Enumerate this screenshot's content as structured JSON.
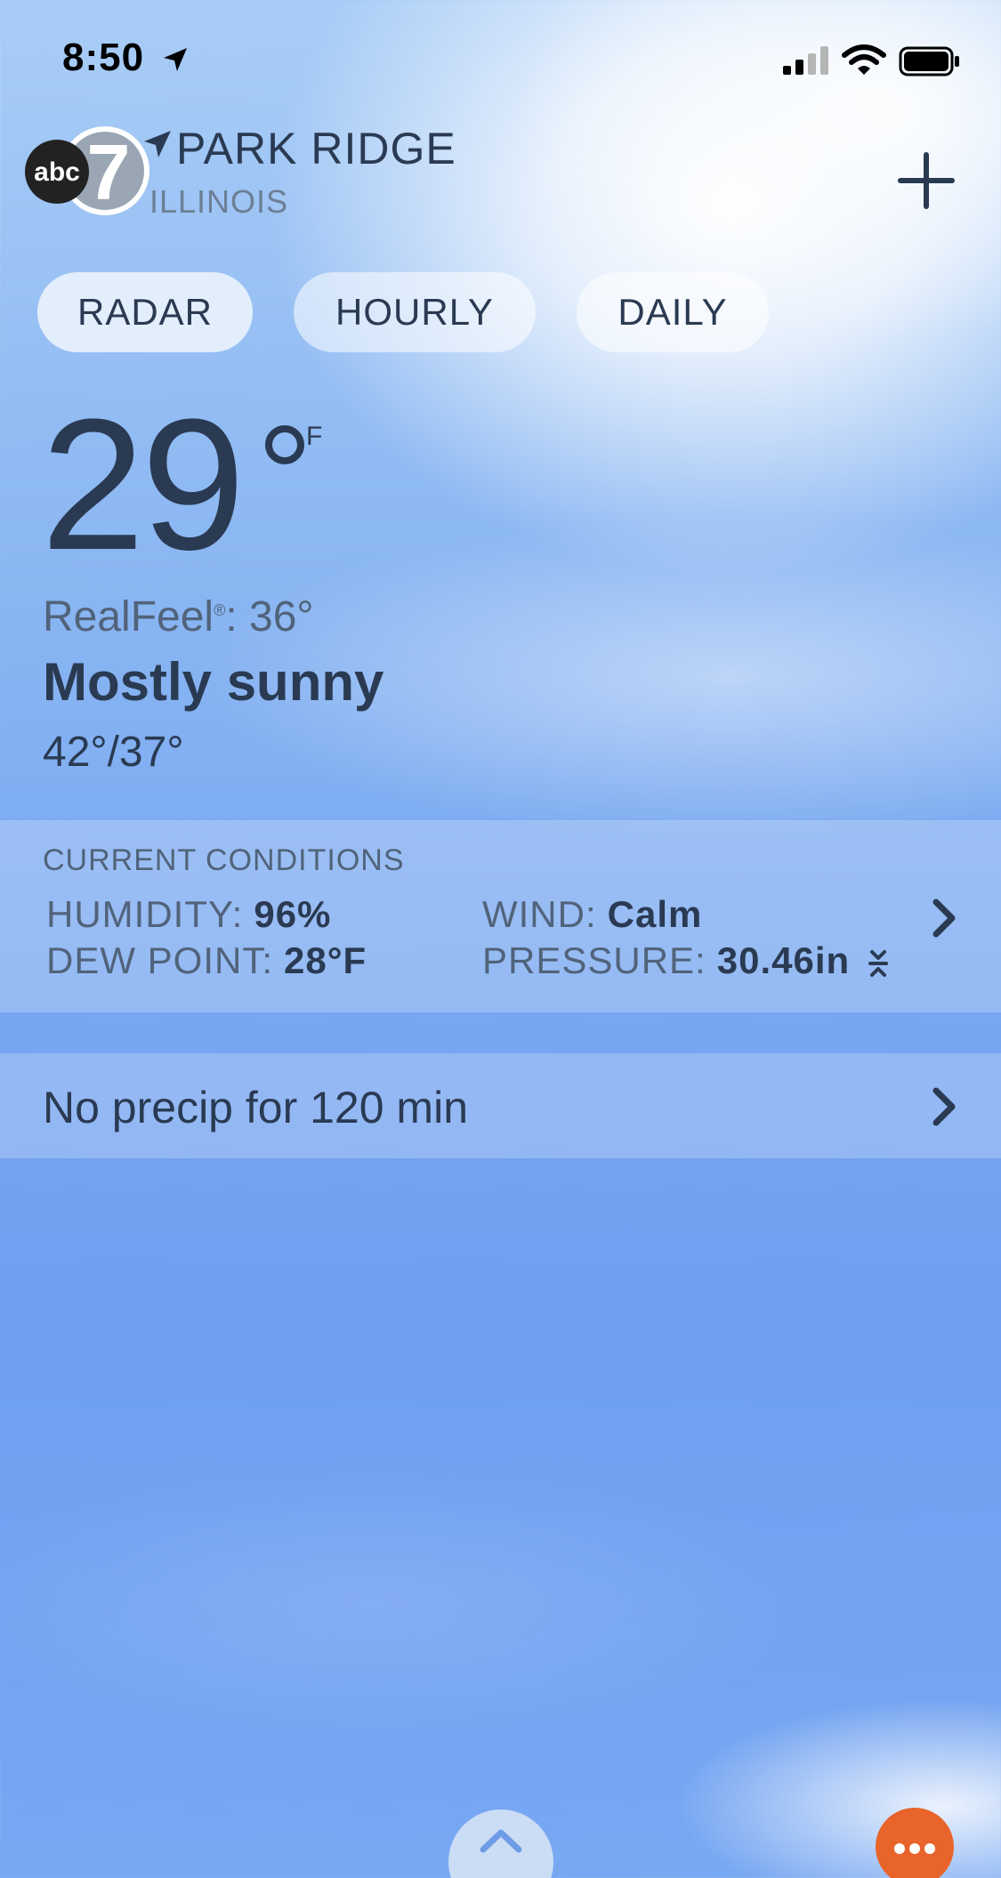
{
  "status_bar": {
    "time": "8:50"
  },
  "header": {
    "city": "PARK RIDGE",
    "state": "ILLINOIS",
    "logo_text": "abc",
    "logo_number": "7"
  },
  "tabs": [
    {
      "label": "RADAR",
      "active": true
    },
    {
      "label": "HOURLY",
      "active": false
    },
    {
      "label": "DAILY",
      "active": false
    }
  ],
  "current": {
    "temperature": "29",
    "unit": "F",
    "realfeel_label": "RealFeel",
    "realfeel_mark": "®",
    "realfeel_value": ": 36°",
    "condition": "Mostly sunny",
    "hi_lo": "42°/37°"
  },
  "conditions": {
    "title": "CURRENT CONDITIONS",
    "humidity_label": "HUMIDITY:",
    "humidity_value": "96%",
    "dew_point_label": "DEW POINT:",
    "dew_point_value": "28°F",
    "wind_label": "WIND:",
    "wind_value": "Calm",
    "pressure_label": "PRESSURE:",
    "pressure_value": "30.46in"
  },
  "precip": {
    "text": "No precip for 120 min"
  },
  "colors": {
    "text": "#2a3a52",
    "muted": "#51637a",
    "more_button": "#e8642a"
  }
}
